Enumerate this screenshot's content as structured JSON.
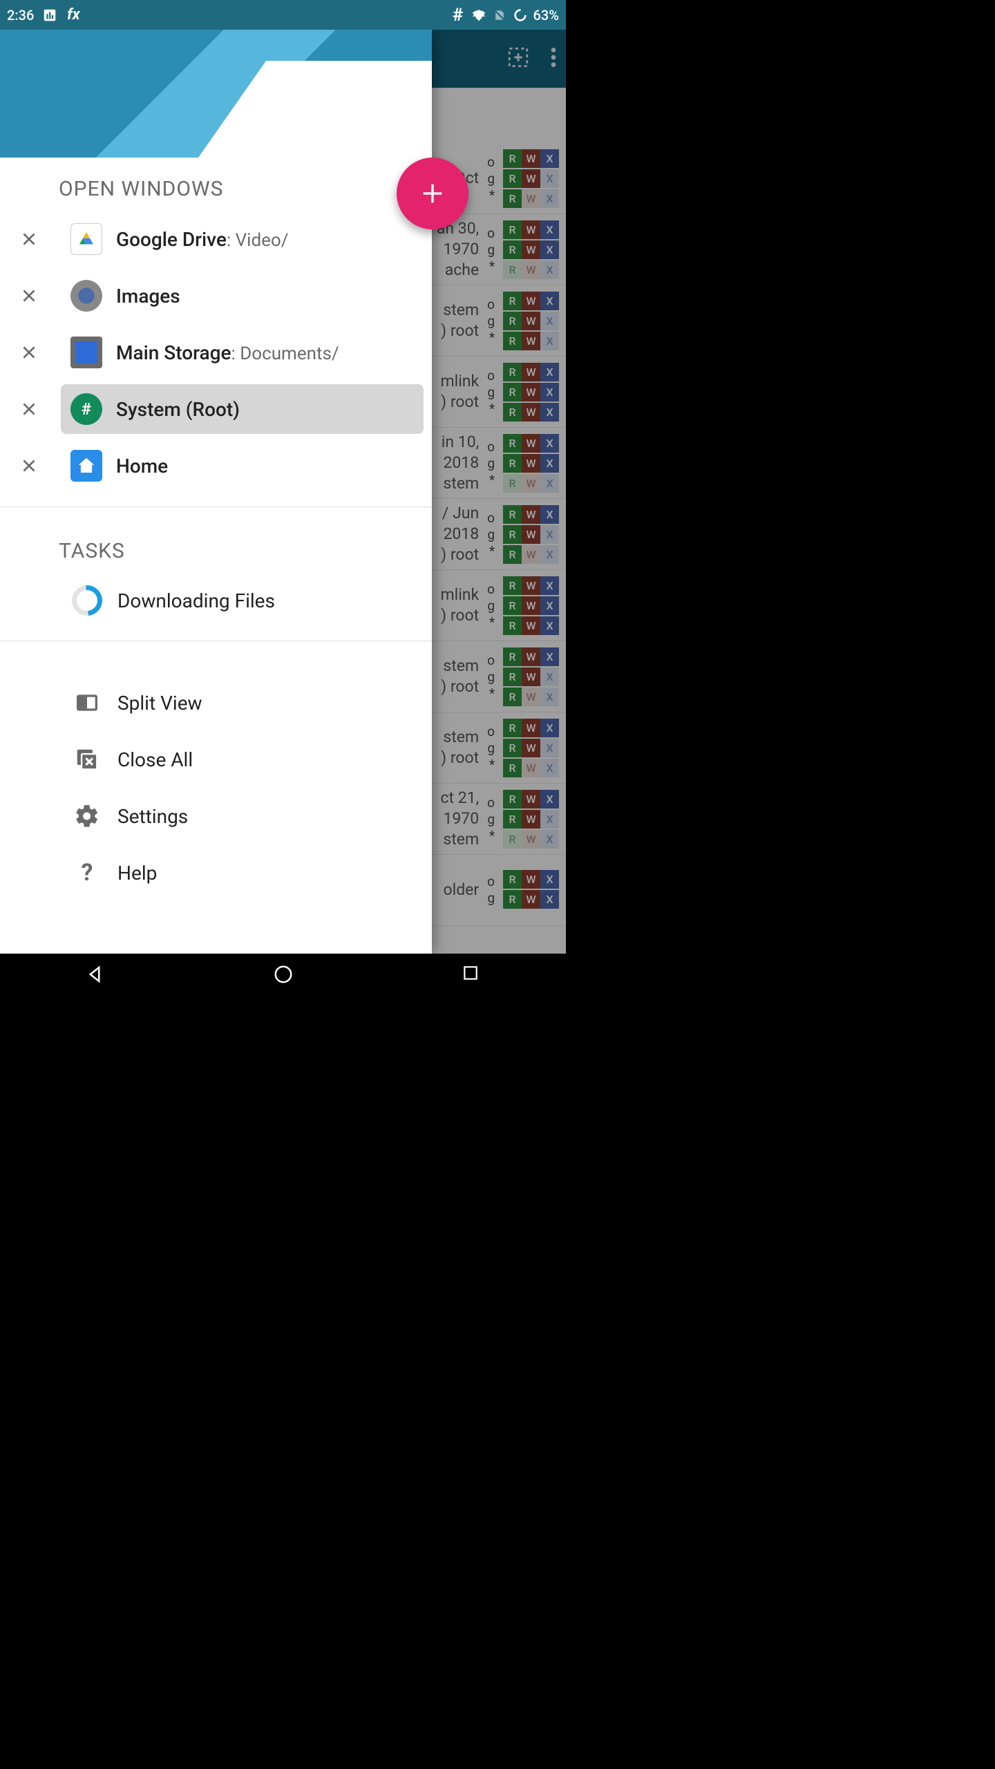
{
  "status": {
    "time": "2:36",
    "battery": "63%"
  },
  "appbar": {},
  "drawer": {
    "open_windows_title": "OPEN WINDOWS",
    "windows": [
      {
        "name": "Google Drive",
        "path": ": Video/"
      },
      {
        "name": "Images",
        "path": ""
      },
      {
        "name": "Main Storage",
        "path": ": Documents/"
      },
      {
        "name": "System (Root)",
        "path": ""
      },
      {
        "name": "Home",
        "path": ""
      }
    ],
    "tasks_title": "TASKS",
    "tasks": [
      {
        "label": "Downloading Files"
      }
    ],
    "actions": {
      "split_view": "Split View",
      "close_all": "Close All",
      "settings": "Settings",
      "help": "Help"
    }
  },
  "background_rows": [
    {
      "t1": "Oct",
      "t2": "",
      "t3": "",
      "o": "o",
      "g": "g",
      "s": "*",
      "perm": "111110100"
    },
    {
      "t1": "an 30,",
      "t2": "1970",
      "t3": "ache",
      "o": "o",
      "g": "g",
      "s": "*",
      "perm": "111111000"
    },
    {
      "t1": "",
      "t2": "stem",
      "t3": ") root",
      "o": "o",
      "g": "g",
      "s": "*",
      "perm": "111110110"
    },
    {
      "t1": "",
      "t2": "mlink",
      "t3": ") root",
      "o": "o",
      "g": "g",
      "s": "*",
      "perm": "111111111"
    },
    {
      "t1": "in 10,",
      "t2": "2018",
      "t3": "stem",
      "o": "o",
      "g": "g",
      "s": "*",
      "perm": "111111000"
    },
    {
      "t1": "/ Jun",
      "t2": "2018",
      "t3": ") root",
      "o": "o",
      "g": "g",
      "s": "*",
      "perm": "111110100"
    },
    {
      "t1": "",
      "t2": "mlink",
      "t3": ") root",
      "o": "o",
      "g": "g",
      "s": "*",
      "perm": "111111111"
    },
    {
      "t1": "",
      "t2": "stem",
      "t3": ") root",
      "o": "o",
      "g": "g",
      "s": "*",
      "perm": "111110100"
    },
    {
      "t1": "",
      "t2": "stem",
      "t3": ") root",
      "o": "o",
      "g": "g",
      "s": "*",
      "perm": "111110100"
    },
    {
      "t1": "ct 21,",
      "t2": "1970",
      "t3": "stem",
      "o": "o",
      "g": "g",
      "s": "*",
      "perm": "111110000"
    },
    {
      "t1": "",
      "t2": "older",
      "t3": "",
      "o": "o",
      "g": "g",
      "s": "",
      "perm": "111111"
    }
  ]
}
